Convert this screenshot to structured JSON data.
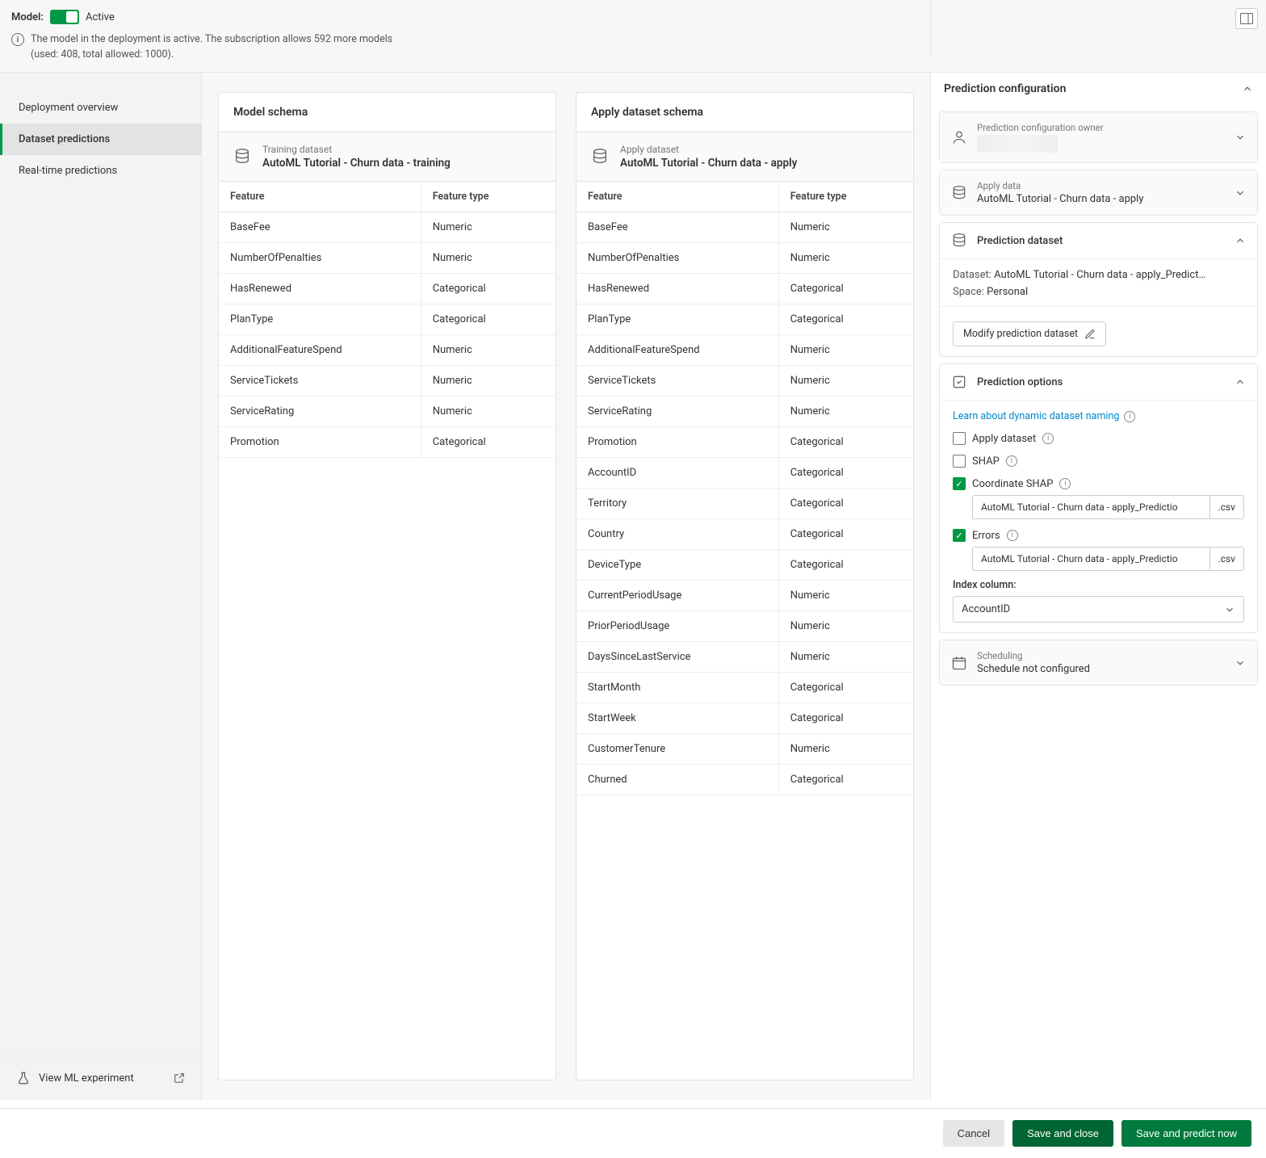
{
  "header": {
    "modelLabel": "Model:",
    "activeLabel": "Active",
    "infoLine1": "The model in the deployment is active. The subscription allows 592 more models",
    "infoLine2": "(used: 408, total allowed: 1000)."
  },
  "sidebar": {
    "items": [
      {
        "label": "Deployment overview",
        "selected": false
      },
      {
        "label": "Dataset predictions",
        "selected": true
      },
      {
        "label": "Real-time predictions",
        "selected": false
      }
    ],
    "footerLabel": "View ML experiment"
  },
  "modelSchema": {
    "title": "Model schema",
    "datasetSub": "Training dataset",
    "datasetName": "AutoML Tutorial - Churn data - training",
    "colFeature": "Feature",
    "colType": "Feature type",
    "rows": [
      {
        "feature": "BaseFee",
        "type": "Numeric"
      },
      {
        "feature": "NumberOfPenalties",
        "type": "Numeric"
      },
      {
        "feature": "HasRenewed",
        "type": "Categorical"
      },
      {
        "feature": "PlanType",
        "type": "Categorical"
      },
      {
        "feature": "AdditionalFeatureSpend",
        "type": "Numeric"
      },
      {
        "feature": "ServiceTickets",
        "type": "Numeric"
      },
      {
        "feature": "ServiceRating",
        "type": "Numeric"
      },
      {
        "feature": "Promotion",
        "type": "Categorical"
      }
    ]
  },
  "applySchema": {
    "title": "Apply dataset schema",
    "datasetSub": "Apply dataset",
    "datasetName": "AutoML Tutorial - Churn data - apply",
    "colFeature": "Feature",
    "colType": "Feature type",
    "rows": [
      {
        "feature": "BaseFee",
        "type": "Numeric"
      },
      {
        "feature": "NumberOfPenalties",
        "type": "Numeric"
      },
      {
        "feature": "HasRenewed",
        "type": "Categorical"
      },
      {
        "feature": "PlanType",
        "type": "Categorical"
      },
      {
        "feature": "AdditionalFeatureSpend",
        "type": "Numeric"
      },
      {
        "feature": "ServiceTickets",
        "type": "Numeric"
      },
      {
        "feature": "ServiceRating",
        "type": "Numeric"
      },
      {
        "feature": "Promotion",
        "type": "Categorical"
      },
      {
        "feature": "AccountID",
        "type": "Categorical"
      },
      {
        "feature": "Territory",
        "type": "Categorical"
      },
      {
        "feature": "Country",
        "type": "Categorical"
      },
      {
        "feature": "DeviceType",
        "type": "Categorical"
      },
      {
        "feature": "CurrentPeriodUsage",
        "type": "Numeric"
      },
      {
        "feature": "PriorPeriodUsage",
        "type": "Numeric"
      },
      {
        "feature": "DaysSinceLastService",
        "type": "Numeric"
      },
      {
        "feature": "StartMonth",
        "type": "Categorical"
      },
      {
        "feature": "StartWeek",
        "type": "Categorical"
      },
      {
        "feature": "CustomerTenure",
        "type": "Numeric"
      },
      {
        "feature": "Churned",
        "type": "Categorical"
      }
    ]
  },
  "rightPanel": {
    "title": "Prediction configuration",
    "ownerSub": "Prediction configuration owner",
    "applyDataSub": "Apply data",
    "applyDataName": "AutoML Tutorial - Churn data - apply",
    "predDatasetTitle": "Prediction dataset",
    "datasetLabel": "Dataset:",
    "datasetValue": "AutoML Tutorial - Churn data - apply_Predict…",
    "spaceLabel": "Space:",
    "spaceValue": "Personal",
    "modifyBtn": "Modify prediction dataset",
    "predOptionsTitle": "Prediction options",
    "learnLink": "Learn about dynamic dataset naming",
    "applyDatasetOpt": "Apply dataset",
    "shapOpt": "SHAP",
    "coordShapOpt": "Coordinate SHAP",
    "coordShapFile": "AutoML Tutorial - Churn data - apply_Predictio",
    "errorsOpt": "Errors",
    "errorsFile": "AutoML Tutorial - Churn data - apply_Predictio",
    "fileExt": ".csv",
    "indexColLabel": "Index column:",
    "indexColValue": "AccountID",
    "schedulingSub": "Scheduling",
    "schedulingValue": "Schedule not configured"
  },
  "actions": {
    "cancel": "Cancel",
    "saveClose": "Save and close",
    "savePredict": "Save and predict now"
  }
}
